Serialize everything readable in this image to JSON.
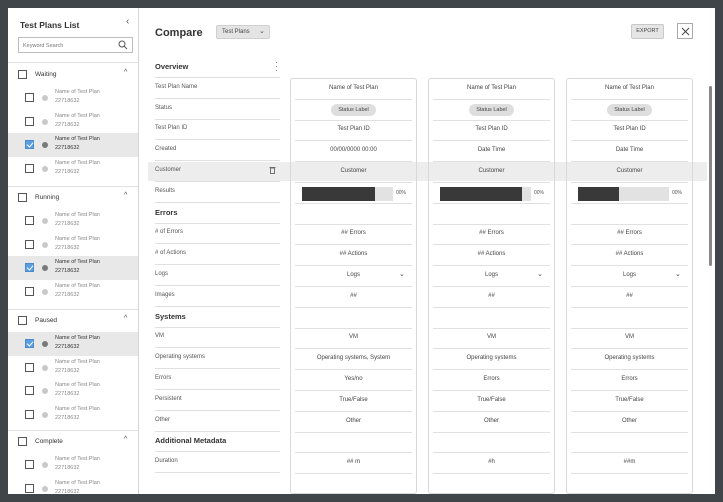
{
  "sidebar": {
    "title": "Test Plans List",
    "collapse_icon": "chevron-left-icon",
    "search_placeholder": "Keyword Search",
    "groups": [
      {
        "label": "Waiting",
        "items": [
          {
            "name": "Name of Test Plan",
            "id": "22718632",
            "selected": false
          },
          {
            "name": "Name of Test Plan",
            "id": "22718632",
            "selected": false
          },
          {
            "name": "Name of Test Plan",
            "id": "22718632",
            "selected": true
          },
          {
            "name": "Name of Test Plan",
            "id": "22718632",
            "selected": false
          }
        ]
      },
      {
        "label": "Running",
        "items": [
          {
            "name": "Name of Test Plan",
            "id": "22718632",
            "selected": false
          },
          {
            "name": "Name of Test Plan",
            "id": "22718632",
            "selected": false
          },
          {
            "name": "Name of Test Plan",
            "id": "22718632",
            "selected": true
          },
          {
            "name": "Name of Test Plan",
            "id": "22718632",
            "selected": false
          }
        ]
      },
      {
        "label": "Paused",
        "items": [
          {
            "name": "Name of Test Plan",
            "id": "22718632",
            "selected": true
          },
          {
            "name": "Name of Test Plan",
            "id": "22718632",
            "selected": false
          },
          {
            "name": "Name of Test Plan",
            "id": "22718632",
            "selected": false
          },
          {
            "name": "Name of Test Plan",
            "id": "22718632",
            "selected": false
          }
        ]
      },
      {
        "label": "Complete",
        "items": [
          {
            "name": "Name of Test Plan",
            "id": "22718632",
            "selected": false
          },
          {
            "name": "Name of Test Plan",
            "id": "22718632",
            "selected": false
          }
        ]
      }
    ]
  },
  "header": {
    "title": "Compare",
    "dropdown_value": "Test Plans",
    "export_label": "EXPORT",
    "close_icon": "close-icon"
  },
  "rows": [
    {
      "label": "Overview",
      "type": "section",
      "kebab": true
    },
    {
      "label": "Test Plan Name",
      "type": "text"
    },
    {
      "label": "Status",
      "type": "pill"
    },
    {
      "label": "Test Plan ID",
      "type": "text"
    },
    {
      "label": "Created",
      "type": "text"
    },
    {
      "label": "Customer",
      "type": "text",
      "highlight": true,
      "trash": true
    },
    {
      "label": "Results",
      "type": "bar"
    },
    {
      "label": "Errors",
      "type": "section"
    },
    {
      "label": "# of Errors",
      "type": "text"
    },
    {
      "label": "# of Actions",
      "type": "text"
    },
    {
      "label": "Logs",
      "type": "dropdown"
    },
    {
      "label": "Images",
      "type": "text"
    },
    {
      "label": "Systems",
      "type": "section"
    },
    {
      "label": "VM",
      "type": "text"
    },
    {
      "label": "Operating systems",
      "type": "text"
    },
    {
      "label": "Errors",
      "type": "text"
    },
    {
      "label": "Persistent",
      "type": "text"
    },
    {
      "label": "Other",
      "type": "text"
    },
    {
      "label": "Additional Metadata",
      "type": "section"
    },
    {
      "label": "Duration",
      "type": "text"
    }
  ],
  "columns": [
    {
      "values": [
        "",
        "Name of Test Plan",
        "Status Label",
        "Test Plan ID",
        "00/00/0000  00:00",
        "Customer",
        "",
        "",
        "## Errors",
        "## Actions",
        "Logs",
        "##",
        "",
        "VM",
        "Operating systems, System",
        "Yes/no",
        "True/False",
        "Other",
        "",
        "## m"
      ],
      "results_pct": 0.8,
      "results_label": "00%"
    },
    {
      "values": [
        "",
        "Name of Test Plan",
        "Status Label",
        "Test Plan ID",
        "Date  Time",
        "Customer",
        "",
        "",
        "## Errors",
        "## Actions",
        "Logs",
        "##",
        "",
        "VM",
        "Operating systems",
        "Errors",
        "True/False",
        "Other",
        "",
        "#h"
      ],
      "results_pct": 0.9,
      "results_label": "00%"
    },
    {
      "values": [
        "",
        "Name of Test Plan",
        "Status Label",
        "Test Plan ID",
        "Date  Time",
        "Customer",
        "",
        "",
        "## Errors",
        "## Actions",
        "Logs",
        "##",
        "",
        "VM",
        "Operating systems",
        "Errors",
        "True/False",
        "Other",
        "",
        "##m"
      ],
      "results_pct": 0.45,
      "results_label": "00%"
    }
  ]
}
